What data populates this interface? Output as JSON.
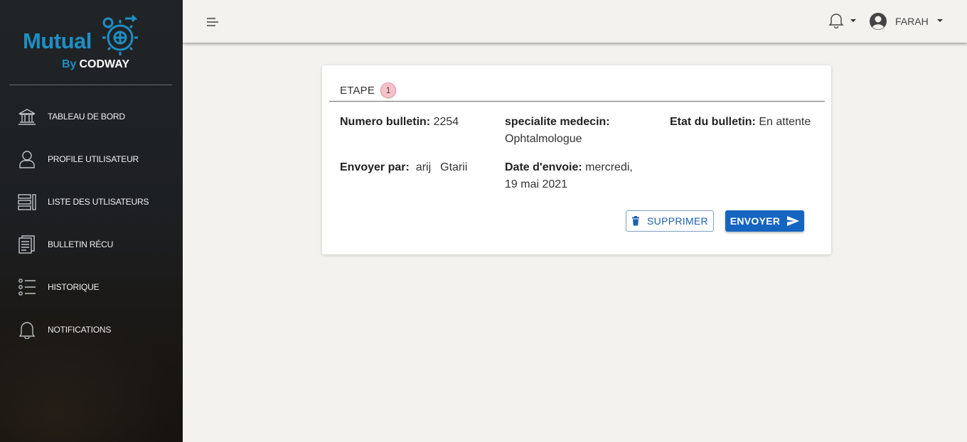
{
  "brand": {
    "name": "Mutual",
    "by": "By",
    "company": "CODWAY",
    "color": "#1d8fc4"
  },
  "sidebar": {
    "items": [
      {
        "label": "TABLEAU DE BORD",
        "icon": "bank-icon"
      },
      {
        "label": "PROFILE UTILISATEUR",
        "icon": "user-icon"
      },
      {
        "label": "LISTE DES UTLISATEURS",
        "icon": "list-icon"
      },
      {
        "label": "BULLETIN RÉCU",
        "icon": "document-icon"
      },
      {
        "label": "HISTORIQUE",
        "icon": "bullet-list-icon"
      },
      {
        "label": "NOTIFICATIONS",
        "icon": "bell-icon"
      }
    ]
  },
  "topbar": {
    "user_name": "FARAH"
  },
  "card": {
    "step_label": "ETAPE",
    "step_number": "1",
    "numero_label": "Numero bulletin:",
    "numero_value": "2254",
    "specialite_label": "specialite medecin:",
    "specialite_value": "Ophtalmologue",
    "etat_label": "Etat du bulletin:",
    "etat_value": "En attente",
    "envoyer_par_label": "Envoyer par:",
    "envoyer_par_first": "arij",
    "envoyer_par_last": "Gtarii",
    "date_label": "Date d'envoie:",
    "date_value": "mercredi, 19 mai 2021",
    "delete_label": "SUPPRIMER",
    "send_label": "ENVOYER"
  },
  "colors": {
    "primary": "#1565c0",
    "badge": "#f6c1c8",
    "sidebar_bg": "#1f2326"
  }
}
